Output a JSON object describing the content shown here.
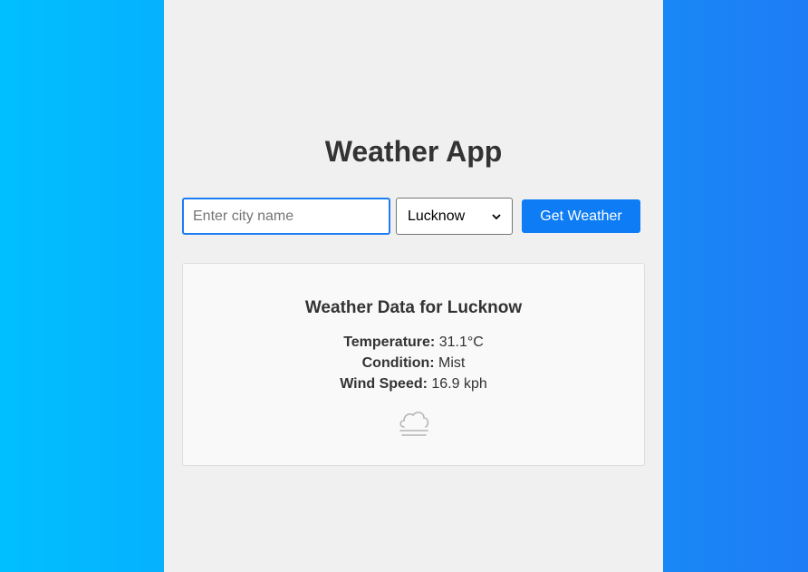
{
  "app": {
    "title": "Weather App"
  },
  "search": {
    "placeholder": "Enter city name",
    "value": "",
    "selected_city": "Lucknow",
    "button_label": "Get Weather"
  },
  "weather": {
    "heading": "Weather Data for Lucknow",
    "temperature_label": "Temperature:",
    "temperature_value": "31.1°C",
    "condition_label": "Condition:",
    "condition_value": "Mist",
    "wind_label": "Wind Speed:",
    "wind_value": "16.9 kph",
    "icon": "mist-cloud-icon"
  },
  "colors": {
    "background_left": "#00bfff",
    "background_right": "#1e7cf5",
    "accent": "#0d7cf5",
    "panel": "#f0f0f0"
  }
}
